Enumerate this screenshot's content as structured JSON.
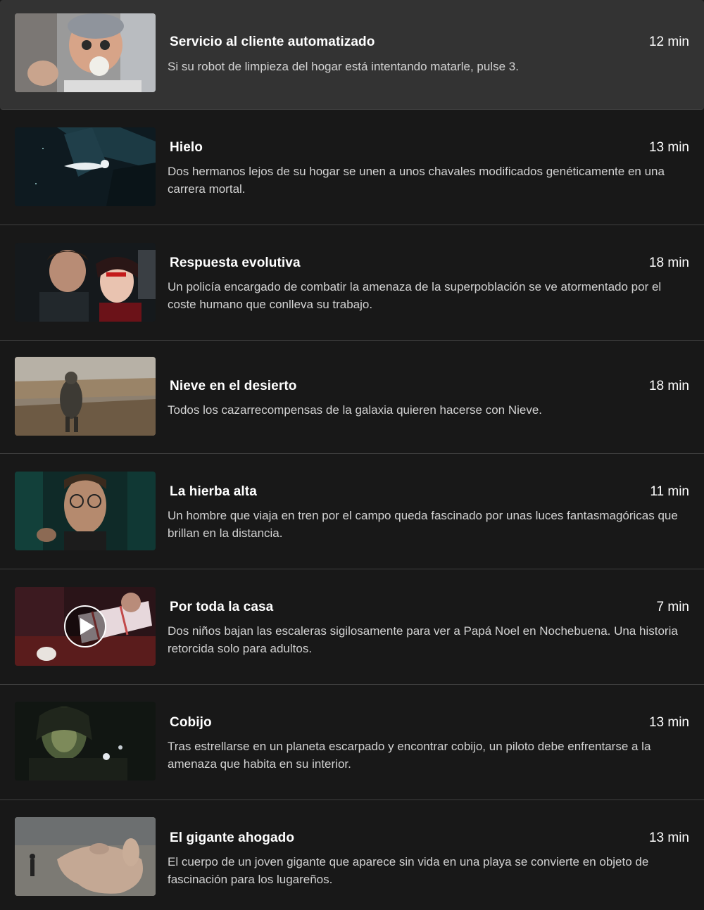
{
  "episodes": [
    {
      "title": "Servicio al cliente automatizado",
      "duration": "12 min",
      "description": "Si su robot de limpieza del hogar está intentando matarle, pulse 3.",
      "active": true,
      "thumbnail": "robot-vacuum-old-woman-dog"
    },
    {
      "title": "Hielo",
      "duration": "13 min",
      "description": "Dos hermanos lejos de su hogar se unen a unos chavales modificados genéticamente en una carrera mortal.",
      "thumbnail": "ice-creature-jump"
    },
    {
      "title": "Respuesta evolutiva",
      "duration": "18 min",
      "description": "Un policía encargado de combatir la amenaza de la superpoblación se ve atormentado por el coste humano que conlleva su trabajo.",
      "thumbnail": "couple-face-to-face"
    },
    {
      "title": "Nieve en el desierto",
      "duration": "18 min",
      "description": "Todos los cazarrecompensas de la galaxia quieren hacerse con Nieve.",
      "thumbnail": "cloaked-figure-desert"
    },
    {
      "title": "La hierba alta",
      "duration": "11 min",
      "description": "Un hombre que viaja en tren por el campo queda fascinado por unas luces fantasmagóricas que brillan en la distancia.",
      "thumbnail": "man-with-glasses-train"
    },
    {
      "title": "Por toda la casa",
      "duration": "7 min",
      "description": "Dos niños bajan las escaleras sigilosamente para ver a Papá Noel en Nochebuena. Una historia retorcida solo para adultos.",
      "thumbnail": "child-gift-box",
      "show_play": true
    },
    {
      "title": "Cobijo",
      "duration": "13 min",
      "description": "Tras estrellarse en un planeta escarpado y encontrar cobijo, un piloto debe enfrentarse a la amenaza que habita en su interior.",
      "thumbnail": "pilot-in-helmet"
    },
    {
      "title": "El gigante ahogado",
      "duration": "13 min",
      "description": "El cuerpo de un joven gigante que aparece sin vida en una playa se convierte en objeto de fascinación para los lugareños.",
      "thumbnail": "giant-hand-on-beach"
    }
  ],
  "colors": {
    "background": "#181818",
    "active_row": "#333333",
    "divider": "#404040",
    "title": "#ffffff",
    "description": "#d2d2d2"
  },
  "icons": {
    "play": "play-icon"
  }
}
